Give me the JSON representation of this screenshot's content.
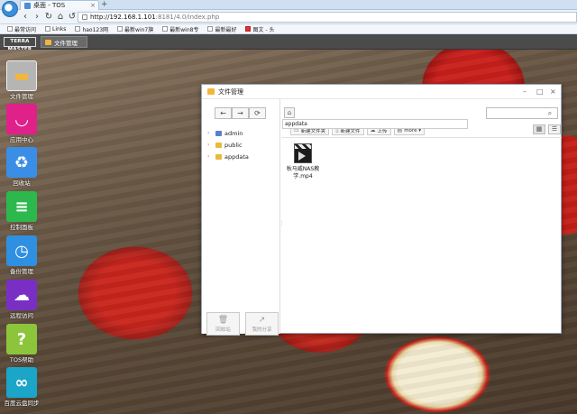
{
  "browser": {
    "tab_title": "桌面 - TOS",
    "tab_close": "×",
    "new_tab": "+",
    "url_host": "http://192.168.1.101",
    "url_path": ":8181/4.0/index.php",
    "nav": {
      "back": "‹",
      "forward": "›",
      "reload": "↻",
      "home": "⌂",
      "undo": "↺",
      "star": "☆"
    }
  },
  "bookmarks": [
    {
      "label": "最常访问",
      "red": false
    },
    {
      "label": "Links",
      "red": false
    },
    {
      "label": "hao123网",
      "red": false
    },
    {
      "label": "最新win7旗",
      "red": false
    },
    {
      "label": "最新win8专",
      "red": false
    },
    {
      "label": "最新最好",
      "red": false
    },
    {
      "label": "图文 - 头",
      "red": true
    }
  ],
  "taskbar": {
    "logo": "TERRA MASTER",
    "task_label": "文件管理"
  },
  "desktop_icons": [
    {
      "label": "文件管理",
      "color": "#b5b5b5",
      "glyph": "▬"
    },
    {
      "label": "应用中心",
      "color": "#e0218a",
      "glyph": "◡"
    },
    {
      "label": "回收站",
      "color": "#3a8ee6",
      "glyph": "♻"
    },
    {
      "label": "控制面板",
      "color": "#2db84d",
      "glyph": "≡"
    },
    {
      "label": "备份管理",
      "color": "#2f8fe0",
      "glyph": "◷"
    },
    {
      "label": "远程访问",
      "color": "#7a2fc4",
      "glyph": "☁"
    },
    {
      "label": "TOS帮助",
      "color": "#8cc43c",
      "glyph": "?"
    },
    {
      "label": "百度云盘同步",
      "color": "#1aa5c9",
      "glyph": "∞"
    }
  ],
  "window": {
    "title": "文件管理",
    "controls": {
      "minimize": "–",
      "maximize": "□",
      "close": "×"
    },
    "nav": {
      "back": "←",
      "forward": "→",
      "refresh": "⟳"
    },
    "tree": [
      {
        "label": "admin",
        "color": "#5b7fcf"
      },
      {
        "label": "public",
        "color": "#e9b83e"
      },
      {
        "label": "appdata",
        "color": "#e9b83e"
      }
    ],
    "side_buttons": [
      {
        "label": "回收站",
        "icon": "🗑"
      },
      {
        "label": "我的分享",
        "icon": "↗"
      }
    ],
    "path": "appdata",
    "toolbar": [
      {
        "label": "新建文件夹",
        "icon": "▭"
      },
      {
        "label": "新建文件",
        "icon": "▯"
      },
      {
        "label": "上传",
        "icon": "☁"
      },
      {
        "label": "more ▾",
        "icon": "▤"
      }
    ],
    "files": [
      {
        "name": "秋马威NAS教学.mp4"
      }
    ]
  }
}
